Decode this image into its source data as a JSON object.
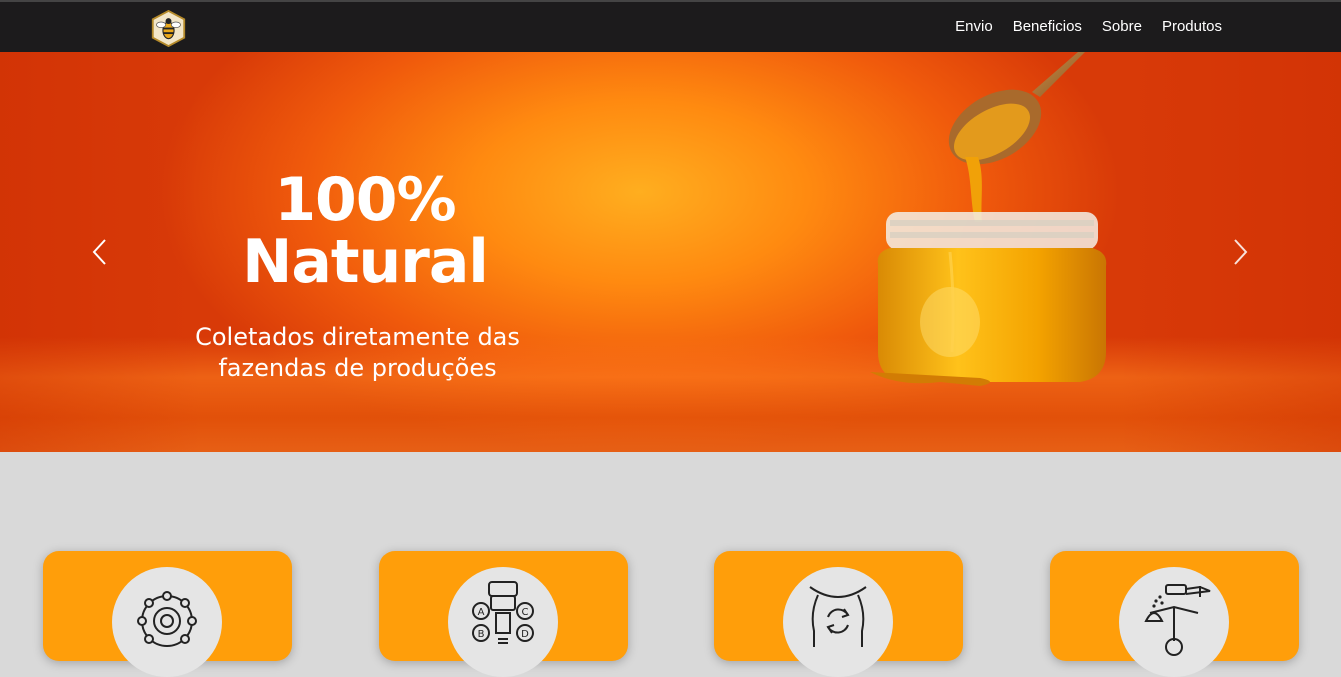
{
  "header": {
    "logo_icon": "bee-logo-icon",
    "nav_items": [
      {
        "label": "Envio"
      },
      {
        "label": "Beneficios"
      },
      {
        "label": "Sobre"
      },
      {
        "label": "Produtos"
      }
    ]
  },
  "hero": {
    "title_line1": "100%",
    "title_line2": "Natural",
    "subtitle_line1": "Coletados diretamente das",
    "subtitle_line2": "fazendas de produções",
    "image_icon": "honey-jar-spoon-image",
    "prev_icon": "chevron-left-icon",
    "next_icon": "chevron-right-icon"
  },
  "cards": [
    {
      "icon": "molecule-icon"
    },
    {
      "icon": "vitamins-abcd-icon"
    },
    {
      "icon": "digestion-body-icon"
    },
    {
      "icon": "scale-dropper-icon"
    }
  ],
  "colors": {
    "navbar": "#1c1b1c",
    "hero_orange": "#f05a0c",
    "card_orange": "#ff9e0a",
    "section_bg": "#d9d9d9"
  }
}
